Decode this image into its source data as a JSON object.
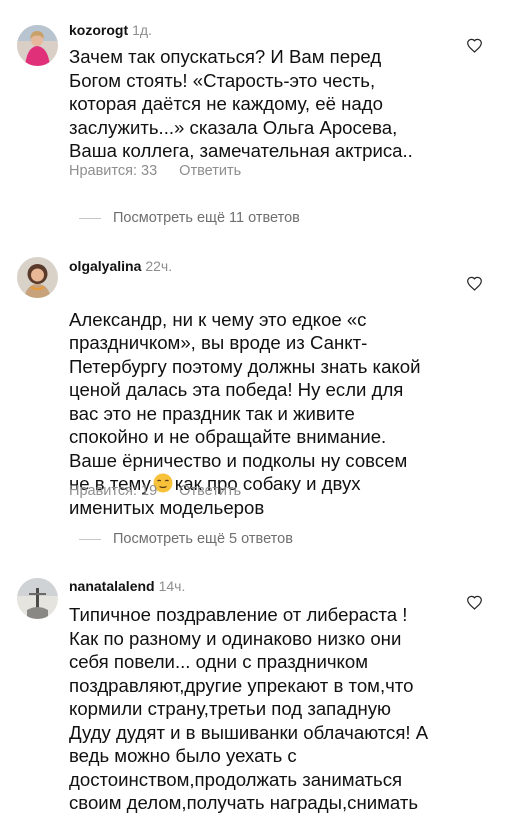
{
  "comments": [
    {
      "username": "kozorogt",
      "time": "1д.",
      "text": "Зачем так опускаться? И Вам перед\nБогом стоять! «Старость-это честь,\nкоторая даётся не каждому, её надо\nзаслужить...» сказала Ольга Аросева,\nВаша коллега, замечательная актриса..",
      "likes": "Нравится: 33",
      "reply": "Ответить",
      "more_replies": "Посмотреть ещё 11 ответов"
    },
    {
      "username": "olgalyalina",
      "time": "22ч.",
      "text_before_emoji": "Александр, ни к чему это едкое «с\nпраздничком», вы вроде из Санкт-\nПетербургу поэтому должны знать какой\nценой далась эта победа! Ну если для\nвас это не праздник так и живите\nспокойно и не обращайте внимание.\nВаше ёрничество и подколы ну совсем\nне в тему",
      "text_after_emoji": "как  про собаку и двух\nименитых модельеров",
      "likes": "Нравится: 19",
      "reply": "Ответить",
      "more_replies": "Посмотреть ещё 5 ответов"
    },
    {
      "username": "nanatalalend",
      "time": "14ч.",
      "text": "Типичное поздравление от либераста !\nКак по разному и одинаково низко они\nсебя повели... одни с праздничком\nпоздравляют,другие упрекают в том,что\nкормили страну,третьи под западную\nДуду дудят и в вышиванки облачаются! А\nведь можно было уехать с\nдостоинством,продолжать заниматься\nсвоим делом,получать награды,снимать"
    }
  ],
  "icons": {
    "like": "heart-outline-icon",
    "emoji": "relieved-face-emoji"
  },
  "colors": {
    "text": "#111111",
    "muted": "#8e8e8e",
    "divider": "#c7c7c7"
  }
}
